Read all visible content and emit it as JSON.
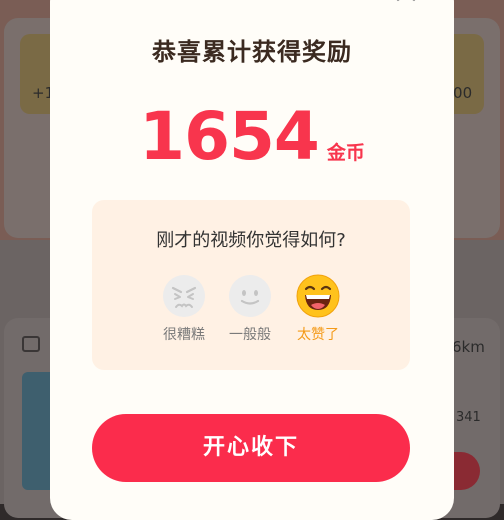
{
  "background": {
    "left_reward_fragment": "+1",
    "right_reward_fragment": ":00",
    "distance_fragment": "6km",
    "count_fragment": "341"
  },
  "modal": {
    "title": "恭喜累计获得奖励",
    "amount": "1654",
    "unit": "金币",
    "feedback": {
      "question": "刚才的视频你觉得如何?",
      "options": [
        {
          "label": "很糟糕",
          "icon": "angry-face-icon",
          "selected": false
        },
        {
          "label": "一般般",
          "icon": "neutral-face-icon",
          "selected": false
        },
        {
          "label": "太赞了",
          "icon": "laughing-face-icon",
          "selected": true
        }
      ]
    },
    "accept_label": "开心收下"
  },
  "colors": {
    "accent_red": "#fb2c4c",
    "selected_orange": "#f49a18",
    "feedback_bg": "#fff1e4"
  }
}
